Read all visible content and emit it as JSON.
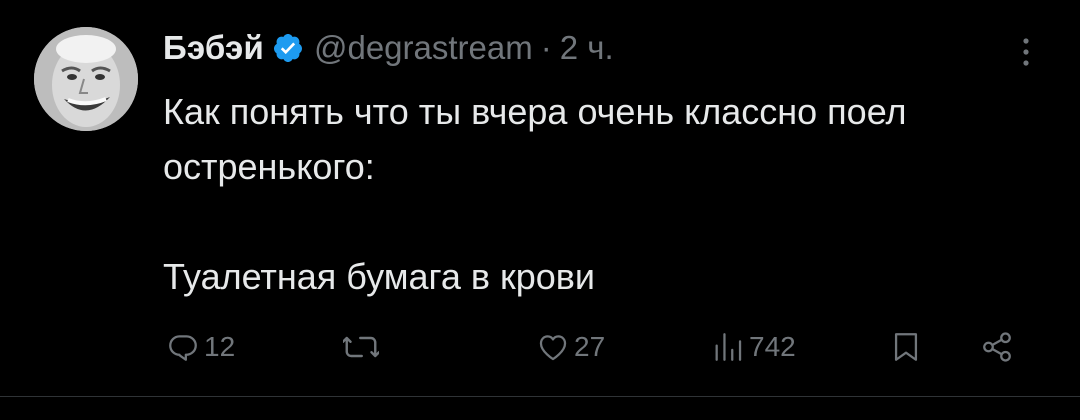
{
  "tweet": {
    "author": {
      "display_name": "Бэбэй",
      "handle": "@degrastream",
      "verified": true
    },
    "separator": "·",
    "time": "2 ч.",
    "text": {
      "line1": "Как понять что ты вчера очень классно поел",
      "line2": "остренького:",
      "line3": "Туалетная бумага в крови"
    },
    "actions": {
      "replies": "12",
      "likes": "27",
      "views": "742"
    }
  },
  "colors": {
    "background": "#000000",
    "text": "#e7e9ea",
    "muted": "#71767b",
    "verified": "#1d9bf0",
    "divider": "#2f3336"
  },
  "icons": [
    "avatar",
    "verified-badge-icon",
    "more-icon",
    "reply-icon",
    "retweet-icon",
    "like-icon",
    "views-icon",
    "bookmark-icon",
    "share-icon"
  ]
}
